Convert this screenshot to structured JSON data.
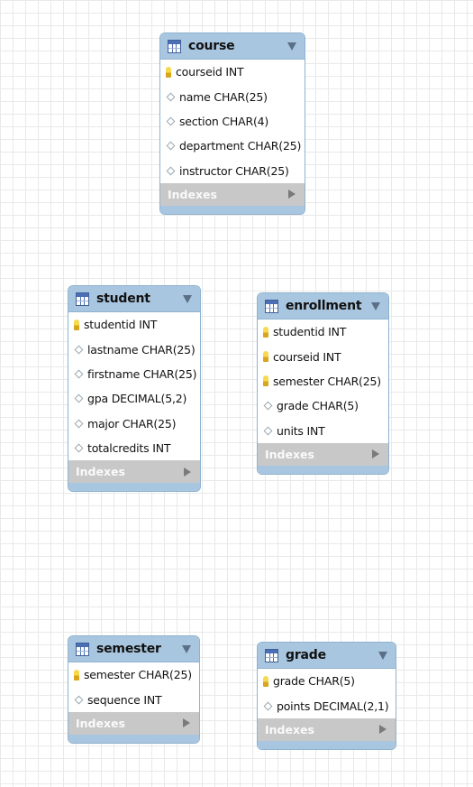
{
  "tables": {
    "course": {
      "title": "course",
      "columns": [
        {
          "key": true,
          "label": "courseid INT"
        },
        {
          "key": false,
          "label": "name CHAR(25)"
        },
        {
          "key": false,
          "label": "section CHAR(4)"
        },
        {
          "key": false,
          "label": "department CHAR(25)"
        },
        {
          "key": false,
          "label": "instructor CHAR(25)"
        }
      ],
      "indexes_label": "Indexes"
    },
    "student": {
      "title": "student",
      "columns": [
        {
          "key": true,
          "label": "studentid INT"
        },
        {
          "key": false,
          "label": "lastname CHAR(25)"
        },
        {
          "key": false,
          "label": "firstname CHAR(25)"
        },
        {
          "key": false,
          "label": "gpa DECIMAL(5,2)"
        },
        {
          "key": false,
          "label": "major CHAR(25)"
        },
        {
          "key": false,
          "label": "totalcredits INT"
        }
      ],
      "indexes_label": "Indexes"
    },
    "enrollment": {
      "title": "enrollment",
      "columns": [
        {
          "key": true,
          "label": "studentid INT"
        },
        {
          "key": true,
          "label": "courseid INT"
        },
        {
          "key": true,
          "label": "semester CHAR(25)"
        },
        {
          "key": false,
          "label": "grade CHAR(5)"
        },
        {
          "key": false,
          "label": "units INT"
        }
      ],
      "indexes_label": "Indexes"
    },
    "semester": {
      "title": "semester",
      "columns": [
        {
          "key": true,
          "label": "semester CHAR(25)"
        },
        {
          "key": false,
          "label": "sequence INT"
        }
      ],
      "indexes_label": "Indexes"
    },
    "grade": {
      "title": "grade",
      "columns": [
        {
          "key": true,
          "label": "grade CHAR(5)"
        },
        {
          "key": false,
          "label": "points DECIMAL(2,1)"
        }
      ],
      "indexes_label": "Indexes"
    }
  }
}
